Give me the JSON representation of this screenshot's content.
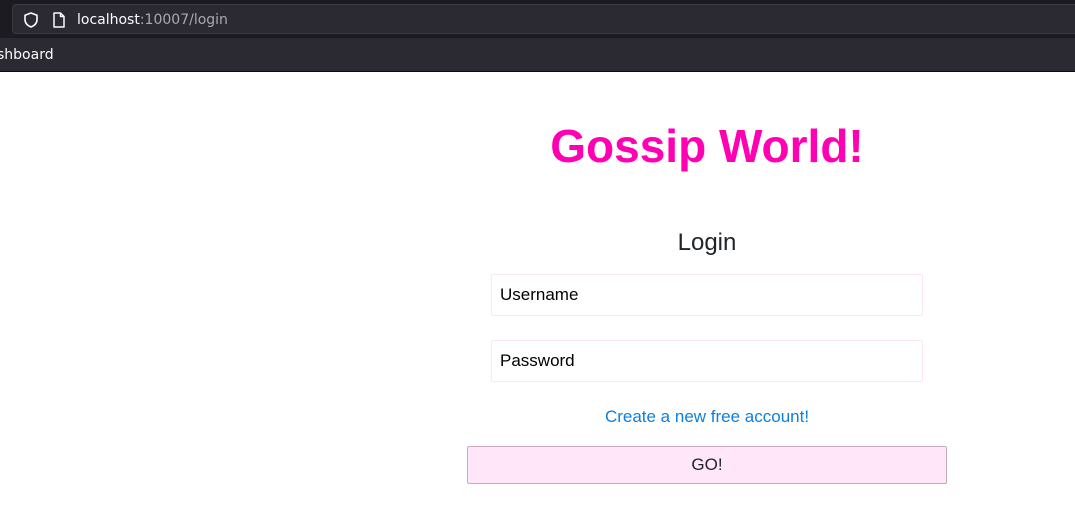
{
  "browser": {
    "url_host": "localhost",
    "url_path": ":10007/login",
    "bookmark_label": "shboard"
  },
  "page": {
    "title": "Gossip World!",
    "login_heading": "Login",
    "username_placeholder": "Username",
    "password_placeholder": "Password",
    "signup_link": "Create a new free account!",
    "submit_label": "GO!"
  },
  "colors": {
    "title": "#ff00b3",
    "link": "#0d7fe0",
    "button_bg": "#ffe6f9",
    "chrome_bg": "#2b2a33"
  },
  "icons": {
    "url_bar_left": "shield-icon",
    "url_bar_page": "page-icon"
  }
}
